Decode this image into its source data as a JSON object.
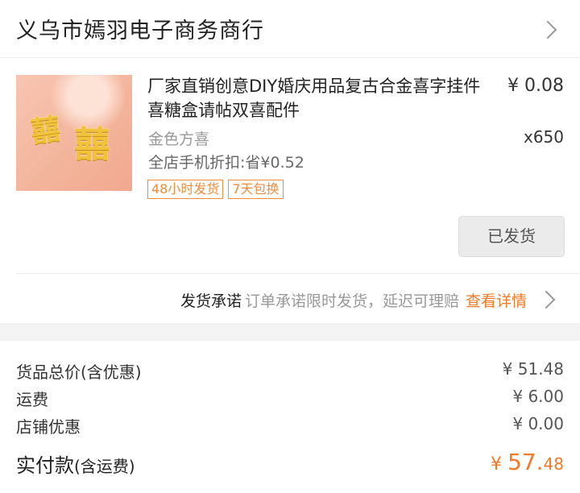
{
  "shop": {
    "name": "义乌市嫣羽电子商务商行"
  },
  "item": {
    "title": "厂家直销创意DIY婚庆用品复古合金喜字挂件 喜糖盒请帖双喜配件",
    "price": "¥ 0.08",
    "variant": "金色方喜",
    "quantity": "x650",
    "discount": "全店手机折扣:省¥0.52",
    "tags": [
      "48小时发货",
      "7天包换"
    ],
    "image_glyph": "囍",
    "status_button": "已发货"
  },
  "promise": {
    "title": "发货承诺",
    "desc": "订单承诺限时发货，延迟可理赔",
    "link": "查看详情"
  },
  "summary": {
    "goods_total_label": "货品总价(含优惠)",
    "goods_total_value": "¥ 51.48",
    "shipping_label": "运费",
    "shipping_value": "¥ 6.00",
    "shop_discount_label": "店铺优惠",
    "shop_discount_value": "¥ 0.00",
    "paid_label": "实付款",
    "paid_label_suffix": "(含运费)",
    "paid_currency": "¥ ",
    "paid_integer": "57.",
    "paid_decimal": "48"
  },
  "colors": {
    "accent": "#f07a28",
    "tag": "#f08c3c"
  }
}
